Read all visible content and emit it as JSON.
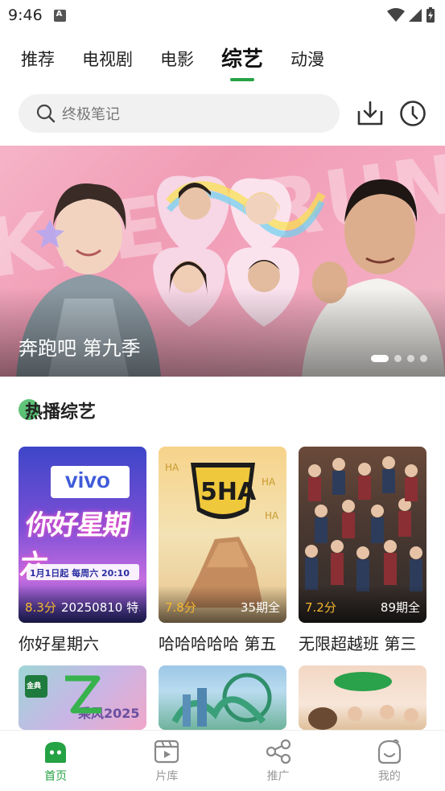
{
  "status": {
    "time": "9:46"
  },
  "tabs": [
    {
      "label": "推荐",
      "active": false
    },
    {
      "label": "电视剧",
      "active": false
    },
    {
      "label": "电影",
      "active": false
    },
    {
      "label": "综艺",
      "active": true
    },
    {
      "label": "动漫",
      "active": false
    }
  ],
  "search": {
    "placeholder": "终极笔记"
  },
  "banner": {
    "title": "奔跑吧 第九季",
    "bg_text": "KEEP RUNNING",
    "page_count": 4,
    "active_index": 0
  },
  "section": {
    "title": "热播综艺"
  },
  "cards": [
    {
      "title": "你好星期六",
      "score": "8.3分",
      "episode": "20250810 特...",
      "poster_text": "你好星期六",
      "poster_brand": "vivo",
      "poster_date": "1月1日起 每周六 20:10"
    },
    {
      "title": "哈哈哈哈哈 第五",
      "score": "7.8分",
      "episode": "35期全",
      "poster_text": "5HA"
    },
    {
      "title": "无限超越班 第三",
      "score": "7.2分",
      "episode": "89期全",
      "poster_text": ""
    }
  ],
  "cards_row2": [
    {
      "poster_text": "乘风2025",
      "poster_brand": "金典"
    },
    {
      "poster_text": ""
    },
    {
      "poster_text": ""
    }
  ],
  "bottom_nav": [
    {
      "label": "首页",
      "active": true,
      "icon": "home-icon"
    },
    {
      "label": "片库",
      "active": false,
      "icon": "library-icon"
    },
    {
      "label": "推广",
      "active": false,
      "icon": "share-icon"
    },
    {
      "label": "我的",
      "active": false,
      "icon": "profile-icon"
    }
  ],
  "colors": {
    "accent": "#25a244",
    "score": "#f5b731"
  }
}
